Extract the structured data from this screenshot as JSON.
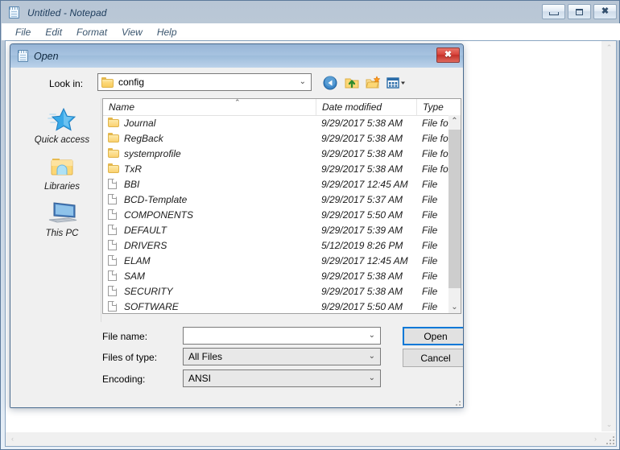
{
  "notepad": {
    "title": "Untitled - Notepad",
    "icon": "notepad-icon",
    "menu": [
      "File",
      "Edit",
      "Format",
      "View",
      "Help"
    ],
    "window_buttons": {
      "minimize": "minimize-button",
      "maximize": "maximize-button",
      "close": "close-button",
      "close_glyph": "✖"
    }
  },
  "dialog": {
    "title": "Open",
    "icon": "notepad-icon",
    "close_glyph": "✖",
    "lookin": {
      "label": "Look in:",
      "value": "config",
      "chevron": "⌄"
    },
    "toolbar": [
      {
        "name": "back-icon",
        "tooltip": "Back"
      },
      {
        "name": "up-one-level-icon",
        "tooltip": "Up one level"
      },
      {
        "name": "new-folder-icon",
        "tooltip": "Create New Folder"
      },
      {
        "name": "views-icon",
        "tooltip": "Views"
      }
    ],
    "places": [
      {
        "label": "Quick access",
        "icon": "star-icon"
      },
      {
        "label": "Libraries",
        "icon": "libraries-folder-icon"
      },
      {
        "label": "This PC",
        "icon": "this-pc-monitor-icon"
      }
    ],
    "columns": [
      "Name",
      "Date modified",
      "Type"
    ],
    "sort_caret": "⌃",
    "files": [
      {
        "name": "Journal",
        "date": "9/29/2017 5:38 AM",
        "type": "File fol",
        "kind": "folder"
      },
      {
        "name": "RegBack",
        "date": "9/29/2017 5:38 AM",
        "type": "File fol",
        "kind": "folder"
      },
      {
        "name": "systemprofile",
        "date": "9/29/2017 5:38 AM",
        "type": "File fol",
        "kind": "folder"
      },
      {
        "name": "TxR",
        "date": "9/29/2017 5:38 AM",
        "type": "File fol",
        "kind": "folder"
      },
      {
        "name": "BBI",
        "date": "9/29/2017 12:45 AM",
        "type": "File",
        "kind": "file"
      },
      {
        "name": "BCD-Template",
        "date": "9/29/2017 5:37 AM",
        "type": "File",
        "kind": "file"
      },
      {
        "name": "COMPONENTS",
        "date": "9/29/2017 5:50 AM",
        "type": "File",
        "kind": "file"
      },
      {
        "name": "DEFAULT",
        "date": "9/29/2017 5:39 AM",
        "type": "File",
        "kind": "file"
      },
      {
        "name": "DRIVERS",
        "date": "5/12/2019 8:26 PM",
        "type": "File",
        "kind": "file"
      },
      {
        "name": "ELAM",
        "date": "9/29/2017 12:45 AM",
        "type": "File",
        "kind": "file"
      },
      {
        "name": "SAM",
        "date": "9/29/2017 5:38 AM",
        "type": "File",
        "kind": "file"
      },
      {
        "name": "SECURITY",
        "date": "9/29/2017 5:38 AM",
        "type": "File",
        "kind": "file"
      },
      {
        "name": "SOFTWARE",
        "date": "9/29/2017 5:50 AM",
        "type": "File",
        "kind": "file"
      }
    ],
    "form": {
      "filename_label": "File name:",
      "filename_value": "",
      "filetype_label": "Files of type:",
      "filetype_value": "All Files",
      "encoding_label": "Encoding:",
      "encoding_value": "ANSI",
      "chevron": "⌄"
    },
    "buttons": {
      "open": "Open",
      "cancel": "Cancel"
    },
    "accent_focus_color": "#0078d7"
  },
  "scroll": {
    "up_arrow": "⌃",
    "down_arrow": "⌄",
    "left_arrow": "‹",
    "right_arrow": "›"
  }
}
